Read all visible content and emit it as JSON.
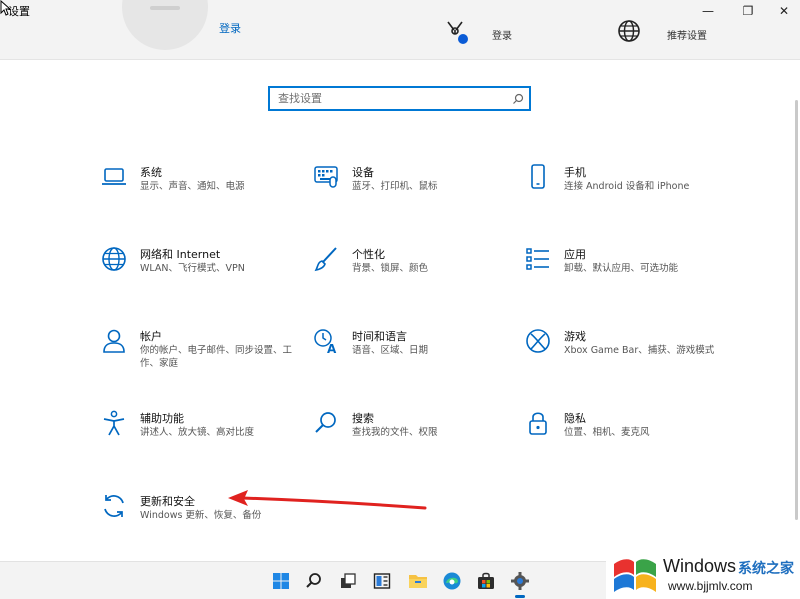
{
  "window": {
    "title": "设置",
    "min_glyph": "—",
    "max_glyph": "❐",
    "close_glyph": "✕"
  },
  "account": {
    "sign_in_link": "登录",
    "onedrive_label": "登录",
    "browse_label": "推荐设置"
  },
  "search": {
    "placeholder": "查找设置"
  },
  "categories": [
    {
      "icon": "laptop-icon",
      "name": "系统",
      "desc": "显示、声音、通知、电源"
    },
    {
      "icon": "keyboard-icon",
      "name": "设备",
      "desc": "蓝牙、打印机、鼠标"
    },
    {
      "icon": "phone-icon",
      "name": "手机",
      "desc": "连接 Android 设备和 iPhone"
    },
    {
      "icon": "globe-icon",
      "name": "网络和 Internet",
      "desc": "WLAN、飞行模式、VPN"
    },
    {
      "icon": "brush-icon",
      "name": "个性化",
      "desc": "背景、锁屏、颜色"
    },
    {
      "icon": "apps-list-icon",
      "name": "应用",
      "desc": "卸载、默认应用、可选功能"
    },
    {
      "icon": "person-icon",
      "name": "帐户",
      "desc": "你的帐户、电子邮件、同步设置、工作、家庭"
    },
    {
      "icon": "time-language-icon",
      "name": "时间和语言",
      "desc": "语音、区域、日期"
    },
    {
      "icon": "xbox-icon",
      "name": "游戏",
      "desc": "Xbox Game Bar、捕获、游戏模式"
    },
    {
      "icon": "accessibility-icon",
      "name": "辅助功能",
      "desc": "讲述人、放大镜、高对比度"
    },
    {
      "icon": "search-icon",
      "name": "搜索",
      "desc": "查找我的文件、权限"
    },
    {
      "icon": "lock-icon",
      "name": "隐私",
      "desc": "位置、相机、麦克风"
    },
    {
      "icon": "sync-icon",
      "name": "更新和安全",
      "desc": "Windows 更新、恢复、备份"
    }
  ],
  "taskbar": [
    "start-icon",
    "search-icon",
    "task-view-icon",
    "widgets-icon",
    "file-explorer-icon",
    "edge-icon",
    "store-icon",
    "settings-icon"
  ],
  "watermark": {
    "brand": "Windows",
    "sub": "系统之家",
    "url": "www.bjjmlv.com"
  },
  "colors": {
    "accent": "#0067c0",
    "annotation": "#e0221f"
  }
}
